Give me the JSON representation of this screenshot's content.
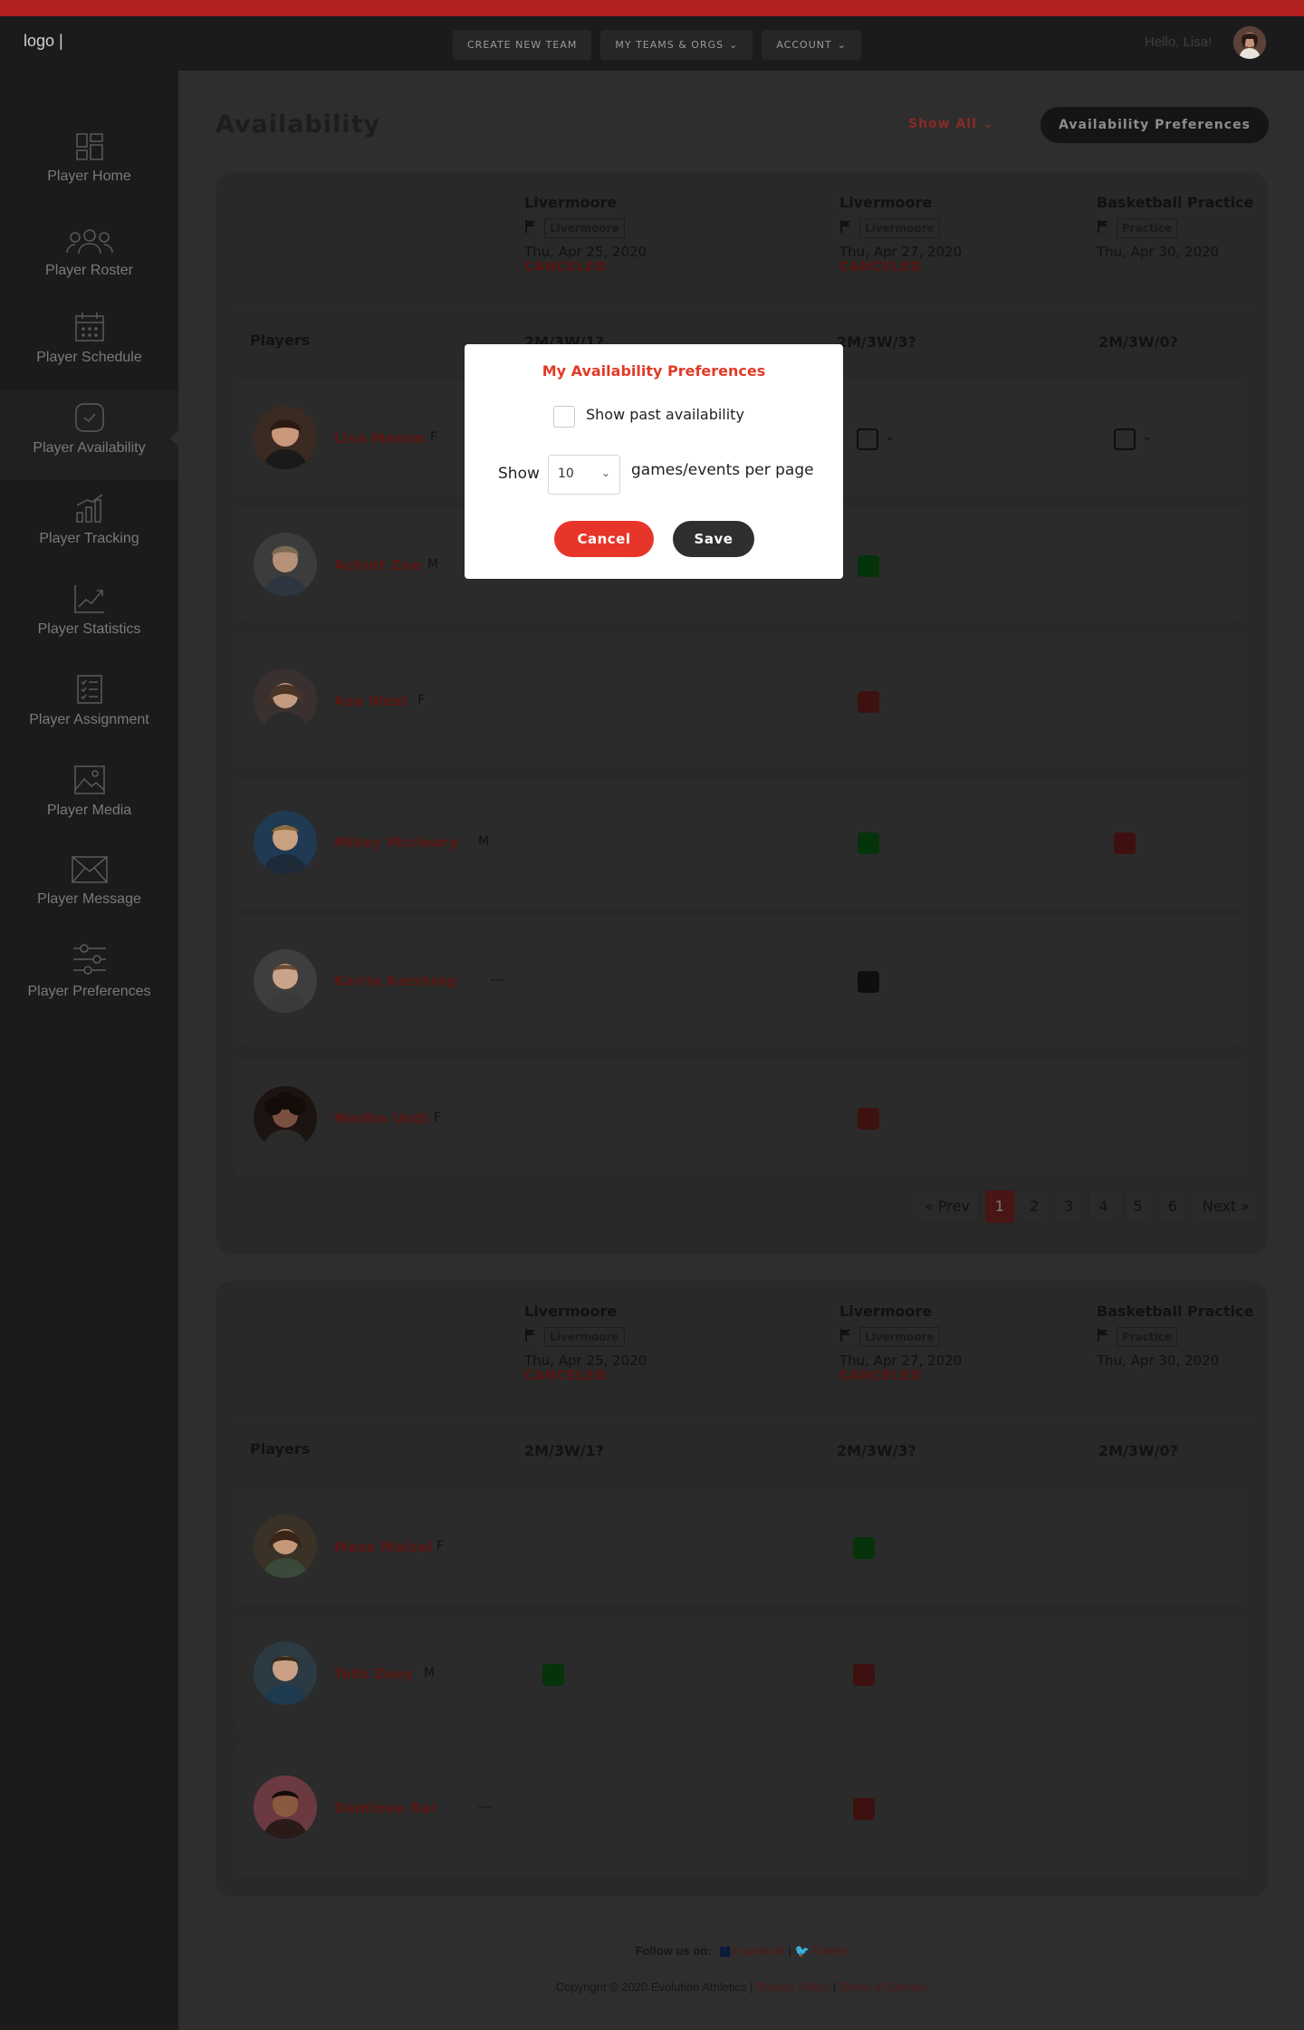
{
  "topbar": {
    "logo": "logo |",
    "nav": [
      {
        "label": "CREATE NEW TEAM",
        "chevron": false
      },
      {
        "label": "MY TEAMS & ORGS",
        "chevron": true
      },
      {
        "label": "ACCOUNT",
        "chevron": true
      }
    ],
    "greeting": "Hello, Lisa!"
  },
  "sidebar": {
    "items": [
      {
        "label": "Player Home",
        "icon": "dashboard-icon"
      },
      {
        "label": "Player Roster",
        "icon": "group-icon"
      },
      {
        "label": "Player Schedule",
        "icon": "calendar-icon"
      },
      {
        "label": "Player Availability",
        "icon": "check-circle-icon",
        "active": true
      },
      {
        "label": "Player Tracking",
        "icon": "bar-chart-icon"
      },
      {
        "label": "Player Statistics",
        "icon": "trend-chart-icon"
      },
      {
        "label": "Player Assignment",
        "icon": "checklist-icon"
      },
      {
        "label": "Player Media",
        "icon": "image-icon"
      },
      {
        "label": "Player Message",
        "icon": "envelope-icon"
      },
      {
        "label": "Player Preferences",
        "icon": "sliders-icon"
      }
    ]
  },
  "page": {
    "title": "Availability",
    "show_all": "Show All",
    "prefs_button": "Availability Preferences"
  },
  "events": [
    {
      "title": "Livermoore",
      "tag": "Livermoore",
      "date": "Thu, Apr 25, 2020",
      "status": "CANCELED",
      "count": "2M/3W/1?"
    },
    {
      "title": "Livermoore",
      "tag": "Livermoore",
      "date": "Thu, Apr 27, 2020",
      "status": "CANCELED",
      "count": "2M/3W/3?"
    },
    {
      "title": "Basketball Practice",
      "tag": "Practice",
      "date": "Thu, Apr 30, 2020",
      "status": "",
      "count": "2M/3W/0?"
    }
  ],
  "players_label": "Players",
  "table1": {
    "rows": [
      {
        "name": "Lisa Menon",
        "gender": "F",
        "cells": [
          "",
          "dropdown",
          "dropdown"
        ]
      },
      {
        "name": "Achint Zoe",
        "gender": "M",
        "cells": [
          "",
          "green",
          ""
        ]
      },
      {
        "name": "Asa West",
        "gender": "F",
        "cells": [
          "",
          "red",
          ""
        ]
      },
      {
        "name": "Mikey Mccleary",
        "gender": "M",
        "cells": [
          "",
          "green",
          "red"
        ]
      },
      {
        "name": "Karila Keishing",
        "gender": "---",
        "cells": [
          "",
          "black",
          ""
        ]
      },
      {
        "name": "Medha Usdi",
        "gender": "F",
        "cells": [
          "",
          "red",
          ""
        ]
      }
    ]
  },
  "pagination": {
    "prev": "« Prev",
    "pages": [
      "1",
      "2",
      "3",
      "4",
      "5",
      "6"
    ],
    "current": "1",
    "next": "Next »"
  },
  "table2": {
    "rows": [
      {
        "name": "Maze Maisel",
        "gender": "F",
        "cells": [
          "",
          "green",
          ""
        ]
      },
      {
        "name": "Teth Zoey",
        "gender": "M",
        "cells": [
          "green",
          "red",
          ""
        ]
      },
      {
        "name": "Daminee Rai",
        "gender": "---",
        "cells": [
          "",
          "red",
          ""
        ]
      }
    ]
  },
  "footer": {
    "follow": "Follow us on:",
    "facebook": "Facebook",
    "twitter": "Twitter",
    "sep": "|",
    "copyright": "Copyright © 2020 Evolution Athletics",
    "privacy": "Privacy Policy",
    "terms": "Terms of Service"
  },
  "modal": {
    "title": "My Availability Preferences",
    "checkbox_label": "Show past availability",
    "show_label": "Show",
    "per_page_value": "10",
    "per_page_label": "games/events per page",
    "cancel": "Cancel",
    "save": "Save"
  },
  "colors": {
    "accent_red": "#e8352a",
    "available_green": "#1a9a2a",
    "unavailable_red": "#c42a28",
    "dark": "#1b1b1c"
  }
}
